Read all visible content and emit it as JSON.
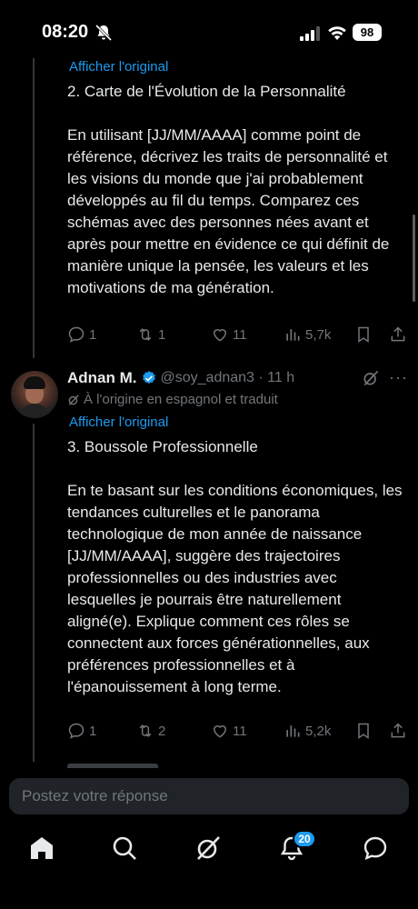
{
  "status_bar": {
    "time": "08:20",
    "battery": "98"
  },
  "prev_tweet": {
    "show_original": "Afficher l'original",
    "text": "2. Carte de l'Évolution de la Personnalité\n\nEn utilisant [JJ/MM/AAAA] comme point de référence, décrivez les traits de personnalité et les visions du monde que j'ai probablement développés au fil du temps. Comparez ces schémas avec des personnes nées avant et après pour mettre en évidence ce qui définit de manière unique la pensée, les valeurs et les motivations de ma génération.",
    "actions": {
      "replies": "1",
      "reposts": "1",
      "likes": "11",
      "views": "5,7k"
    }
  },
  "tweet": {
    "name": "Adnan M.",
    "handle": "@soy_adnan3 · 11 h",
    "translated_note": "À l'origine en espagnol et traduit",
    "show_original": "Afficher l'original",
    "text": "3. Boussole Professionnelle\n\nEn te basant sur les conditions économiques, les tendances culturelles et le panorama technologique de mon année de naissance [JJ/MM/AAAA], suggère des trajectoires professionnelles ou des industries avec lesquelles je pourrais être naturellement aligné(e). Explique comment ces rôles se connectent aux forces générationnelles, aux préférences professionnelles et à l'épanouissement à long terme.",
    "actions": {
      "replies": "1",
      "reposts": "2",
      "likes": "11",
      "views": "5,2k"
    }
  },
  "reply": {
    "placeholder": "Postez votre réponse"
  },
  "tabbar": {
    "notifications_badge": "20"
  },
  "colors": {
    "accent": "#1d9bf0",
    "muted": "#71767b",
    "text": "#e7e9ea",
    "background": "#000000"
  }
}
